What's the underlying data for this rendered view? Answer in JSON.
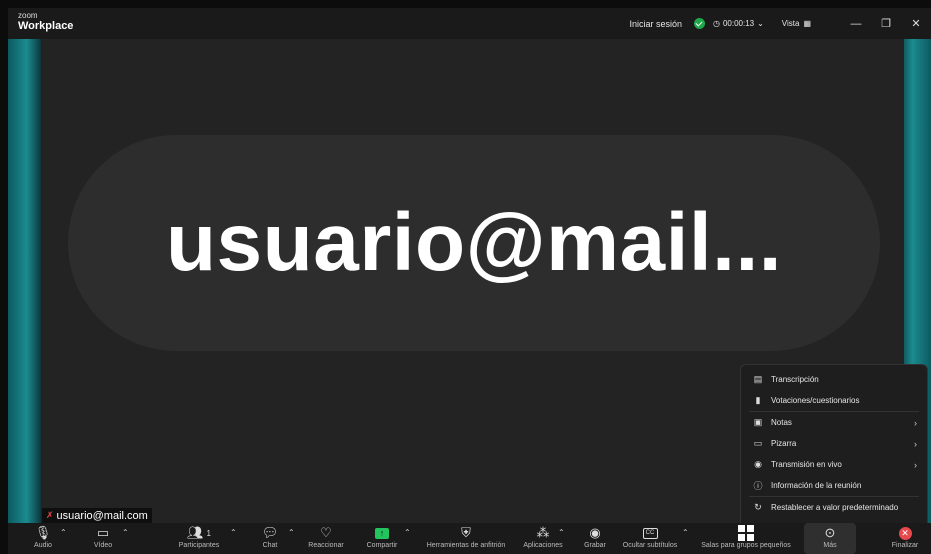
{
  "app": {
    "brand_small": "zoom",
    "brand_name": "Workplace"
  },
  "topbar": {
    "signin": "Iniciar sesión",
    "timer": "00:00:13",
    "view": "Vista",
    "minimize": "—",
    "restore": "❐",
    "close": "✕"
  },
  "stage": {
    "display_name": "usuario@mail...",
    "name_tag": "usuario@mail.com"
  },
  "more_menu": [
    {
      "icon": "transcript-icon",
      "glyph": "▤",
      "label": "Transcripción",
      "submenu": false
    },
    {
      "icon": "polls-icon",
      "glyph": "▮",
      "label": "Votaciones/cuestionarios",
      "submenu": false
    },
    {
      "icon": "notes-icon",
      "glyph": "▣",
      "label": "Notas",
      "submenu": true
    },
    {
      "icon": "whiteboard-icon",
      "glyph": "▭",
      "label": "Pizarra",
      "submenu": true
    },
    {
      "icon": "livestream-icon",
      "glyph": "◉",
      "label": "Transmisión en vivo",
      "submenu": true
    },
    {
      "icon": "info-icon",
      "glyph": "ⓘ",
      "label": "Información de la reunión",
      "submenu": false
    },
    {
      "icon": "reset-icon",
      "glyph": "↻",
      "label": "Restablecer a valor predeterminado",
      "submenu": false
    }
  ],
  "toolbar": {
    "audio": "Audio",
    "video": "Vídeo",
    "participants": "Participantes",
    "participants_count": "1",
    "chat": "Chat",
    "react": "Reaccionar",
    "share": "Compartir",
    "host_tools": "Herramientas de anfitrión",
    "apps": "Aplicaciones",
    "record": "Grabar",
    "captions": "Ocultar subtítulos",
    "breakout": "Salas para grupos pequeños",
    "more": "Más",
    "end": "Finalizar"
  },
  "colors": {
    "accent_green": "#23c45e",
    "danger": "#e5484d",
    "teal_edge": "#1b8b8f"
  }
}
